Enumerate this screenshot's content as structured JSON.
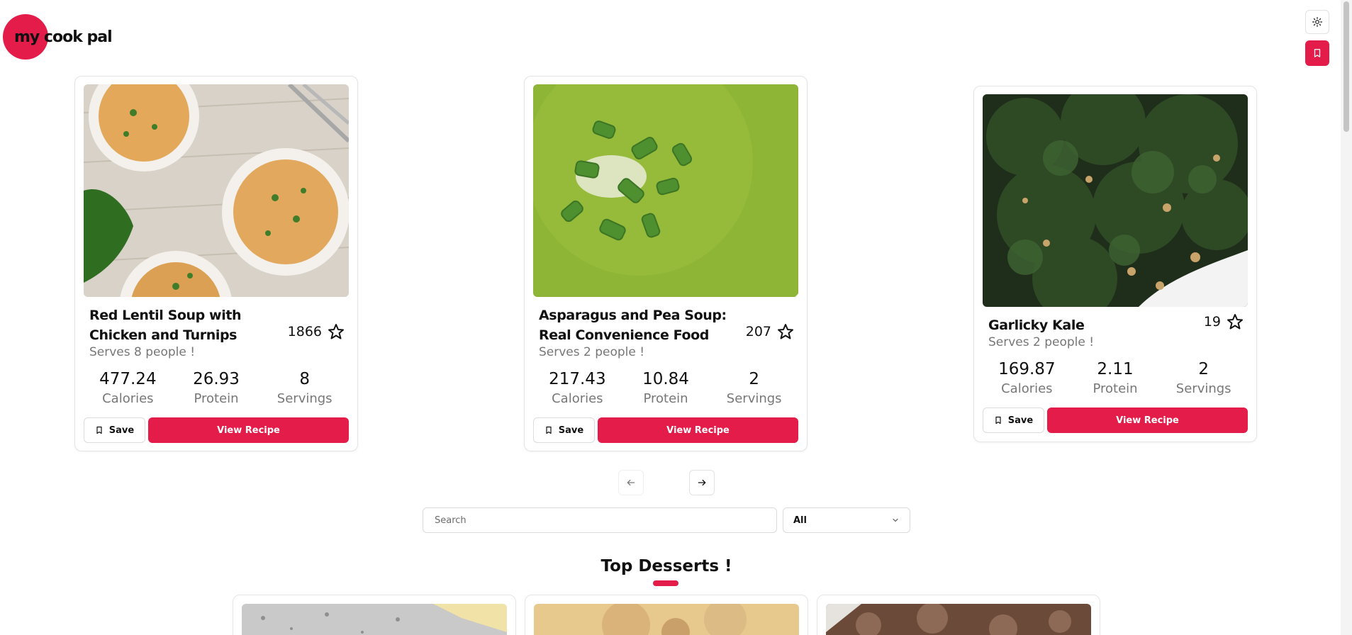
{
  "app": {
    "logo_text": "my cook pal"
  },
  "header": {
    "theme_toggle_icon": "sun-icon",
    "saved_icon": "bookmark-icon"
  },
  "recipes": [
    {
      "title": "Red Lentil Soup with Chicken and Turnips",
      "likes": "1866",
      "serves": "Serves 8 people !",
      "calories": "477.24",
      "protein": "26.93",
      "servings": "8"
    },
    {
      "title": "Asparagus and Pea Soup: Real Convenience Food",
      "likes": "207",
      "serves": "Serves 2 people !",
      "calories": "217.43",
      "protein": "10.84",
      "servings": "2"
    },
    {
      "title": "Garlicky Kale",
      "likes": "19",
      "serves": "Serves 2 people !",
      "calories": "169.87",
      "protein": "2.11",
      "servings": "2"
    }
  ],
  "labels": {
    "calories": "Calories",
    "protein": "Protein",
    "servings": "Servings",
    "save": "Save",
    "view_recipe": "View Recipe"
  },
  "search": {
    "placeholder": "Search"
  },
  "filter": {
    "selected": "All"
  },
  "desserts": {
    "title": "Top Desserts !"
  },
  "colors": {
    "accent": "#e31c4a"
  }
}
